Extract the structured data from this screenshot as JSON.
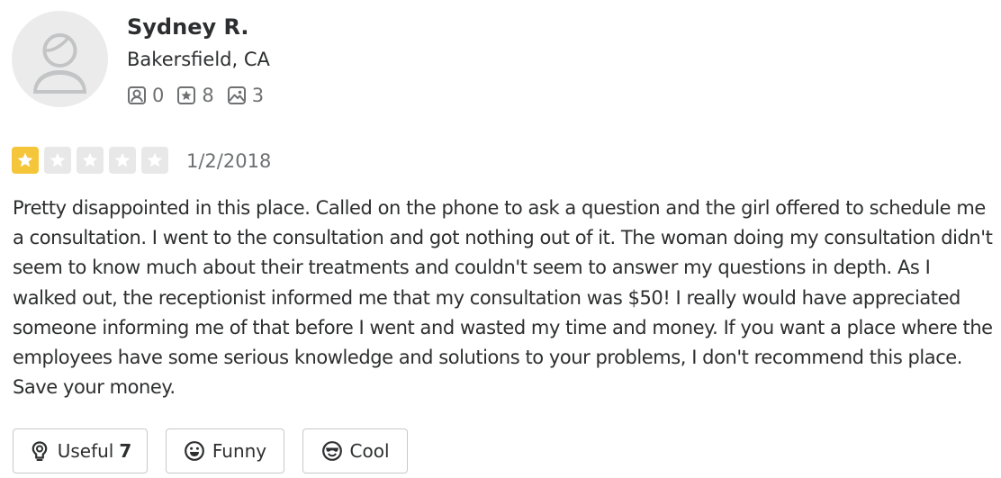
{
  "user": {
    "name": "Sydney R.",
    "location": "Bakersfield, CA",
    "stats": {
      "friends": "0",
      "reviews": "8",
      "photos": "3"
    }
  },
  "review": {
    "rating": 1,
    "max_rating": 5,
    "date": "1/2/2018",
    "text": "Pretty disappointed in this place. Called on the phone to ask a question and the girl offered to schedule me a consultation. I went to the consultation and got nothing out of it. The woman doing my consultation didn't seem to know much about their treatments and couldn't seem to answer my questions in depth. As I walked out, the receptionist informed me that my consultation was $50! I really would have appreciated someone informing me of that before I went and wasted my time and money. If you want a place where the employees have some serious knowledge and solutions to your problems, I don't recommend this place. Save your money."
  },
  "reactions": {
    "useful_label": "Useful",
    "useful_count": "7",
    "funny_label": "Funny",
    "cool_label": "Cool"
  },
  "icons": {
    "avatar": "default-avatar-icon",
    "friends": "friends-icon",
    "reviews": "reviews-star-icon",
    "photos": "photos-icon",
    "useful": "lightbulb-icon",
    "funny": "laughing-face-icon",
    "cool": "sunglasses-face-icon"
  },
  "colors": {
    "star_filled": "#f5c53a",
    "star_empty": "#e8e8e8",
    "text": "#2d2e2f",
    "muted": "#6e7072",
    "border": "#c8c9ca"
  }
}
